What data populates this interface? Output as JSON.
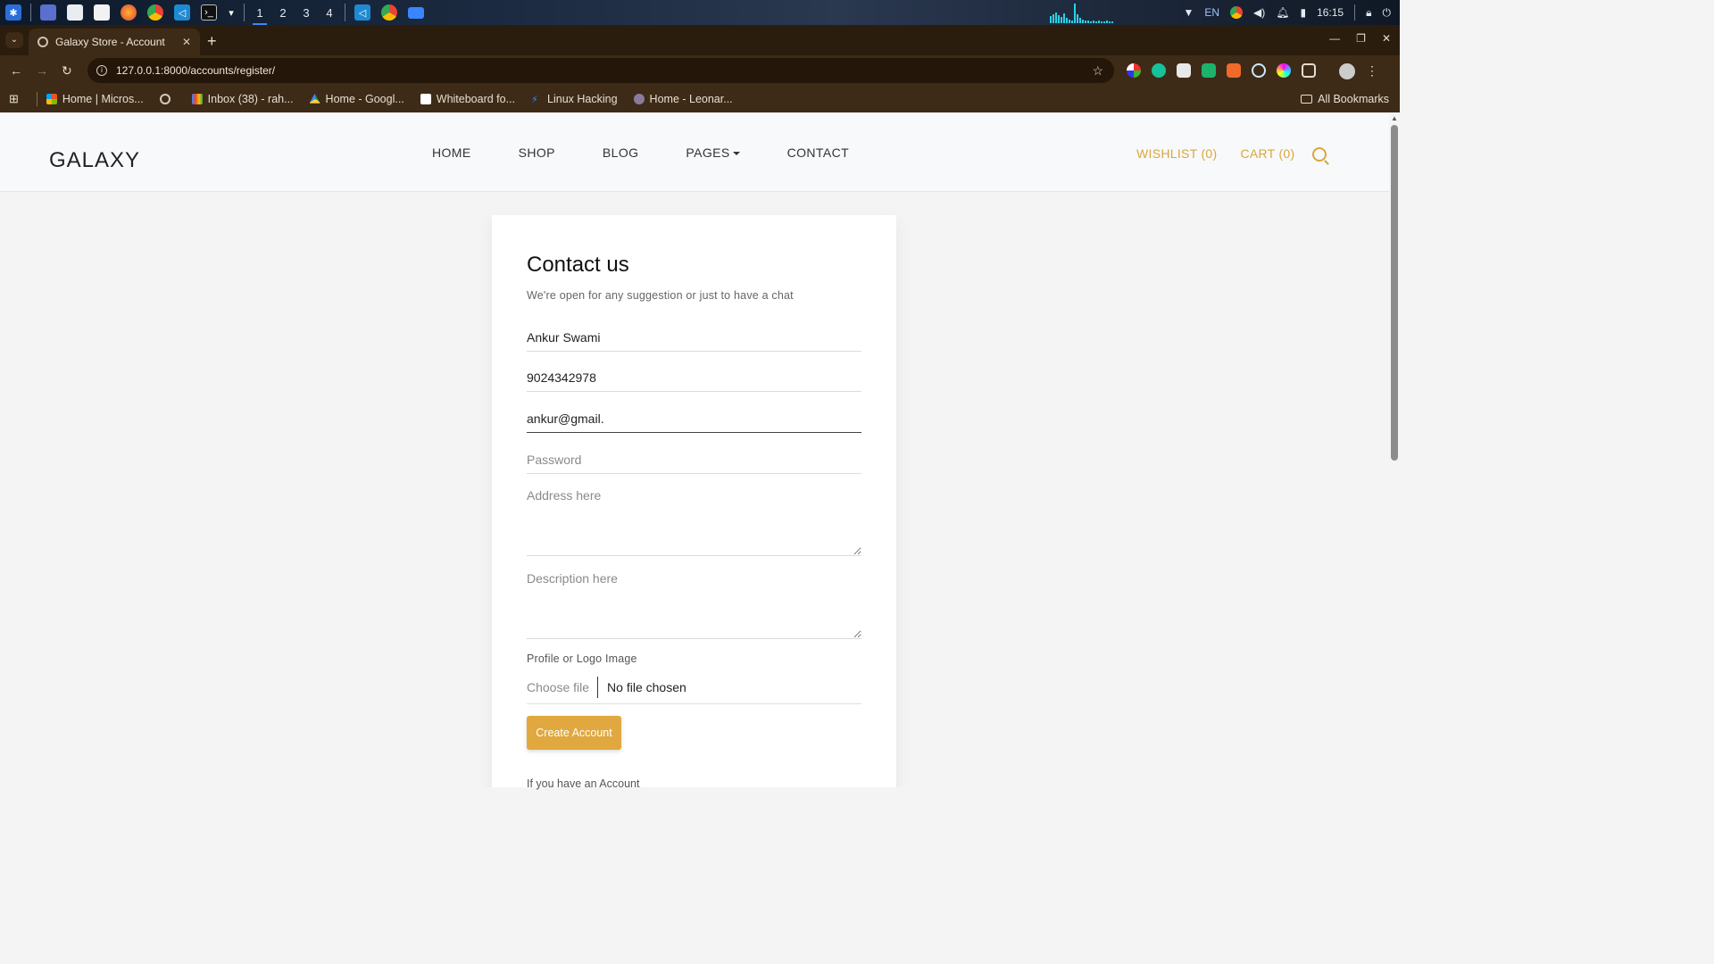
{
  "taskbar": {
    "workspaces": [
      "1",
      "2",
      "3",
      "4"
    ],
    "active_workspace": "1",
    "language": "EN",
    "clock": "16:15"
  },
  "browser": {
    "tab_title": "Galaxy Store - Account",
    "url": "127.0.0.1:8000/accounts/register/",
    "bookmarks": [
      {
        "label": "Home | Micros...",
        "icon": "microsoft-icon"
      },
      {
        "label": "",
        "icon": "globe-icon"
      },
      {
        "label": "Inbox (38) - rah...",
        "icon": "gmail-icon"
      },
      {
        "label": "Home - Googl...",
        "icon": "google-drive-icon"
      },
      {
        "label": "Whiteboard fo...",
        "icon": "whiteboard-icon"
      },
      {
        "label": "Linux Hacking",
        "icon": "link-icon"
      },
      {
        "label": "Home - Leonar...",
        "icon": "leonardo-icon"
      }
    ],
    "all_bookmarks": "All Bookmarks"
  },
  "site": {
    "logo": "GALAXY",
    "nav": {
      "home": "HOME",
      "shop": "SHOP",
      "blog": "BLOG",
      "pages": "PAGES",
      "contact": "CONTACT"
    },
    "wishlist": "WISHLIST (0)",
    "cart": "CART (0)",
    "accent_color": "#d9a63c"
  },
  "form": {
    "title": "Contact us",
    "subtitle": "We're open for any suggestion or just to have a chat",
    "name_value": "Ankur Swami",
    "phone_value": "9024342978",
    "email_value": "ankur@gmail.",
    "password_placeholder": "Password",
    "address_placeholder": "Address here",
    "description_placeholder": "Description here",
    "image_label": "Profile or Logo Image",
    "choose_file": "Choose file",
    "file_status": "No file chosen",
    "submit": "Create Account",
    "footer_text": "If you have an Account"
  }
}
